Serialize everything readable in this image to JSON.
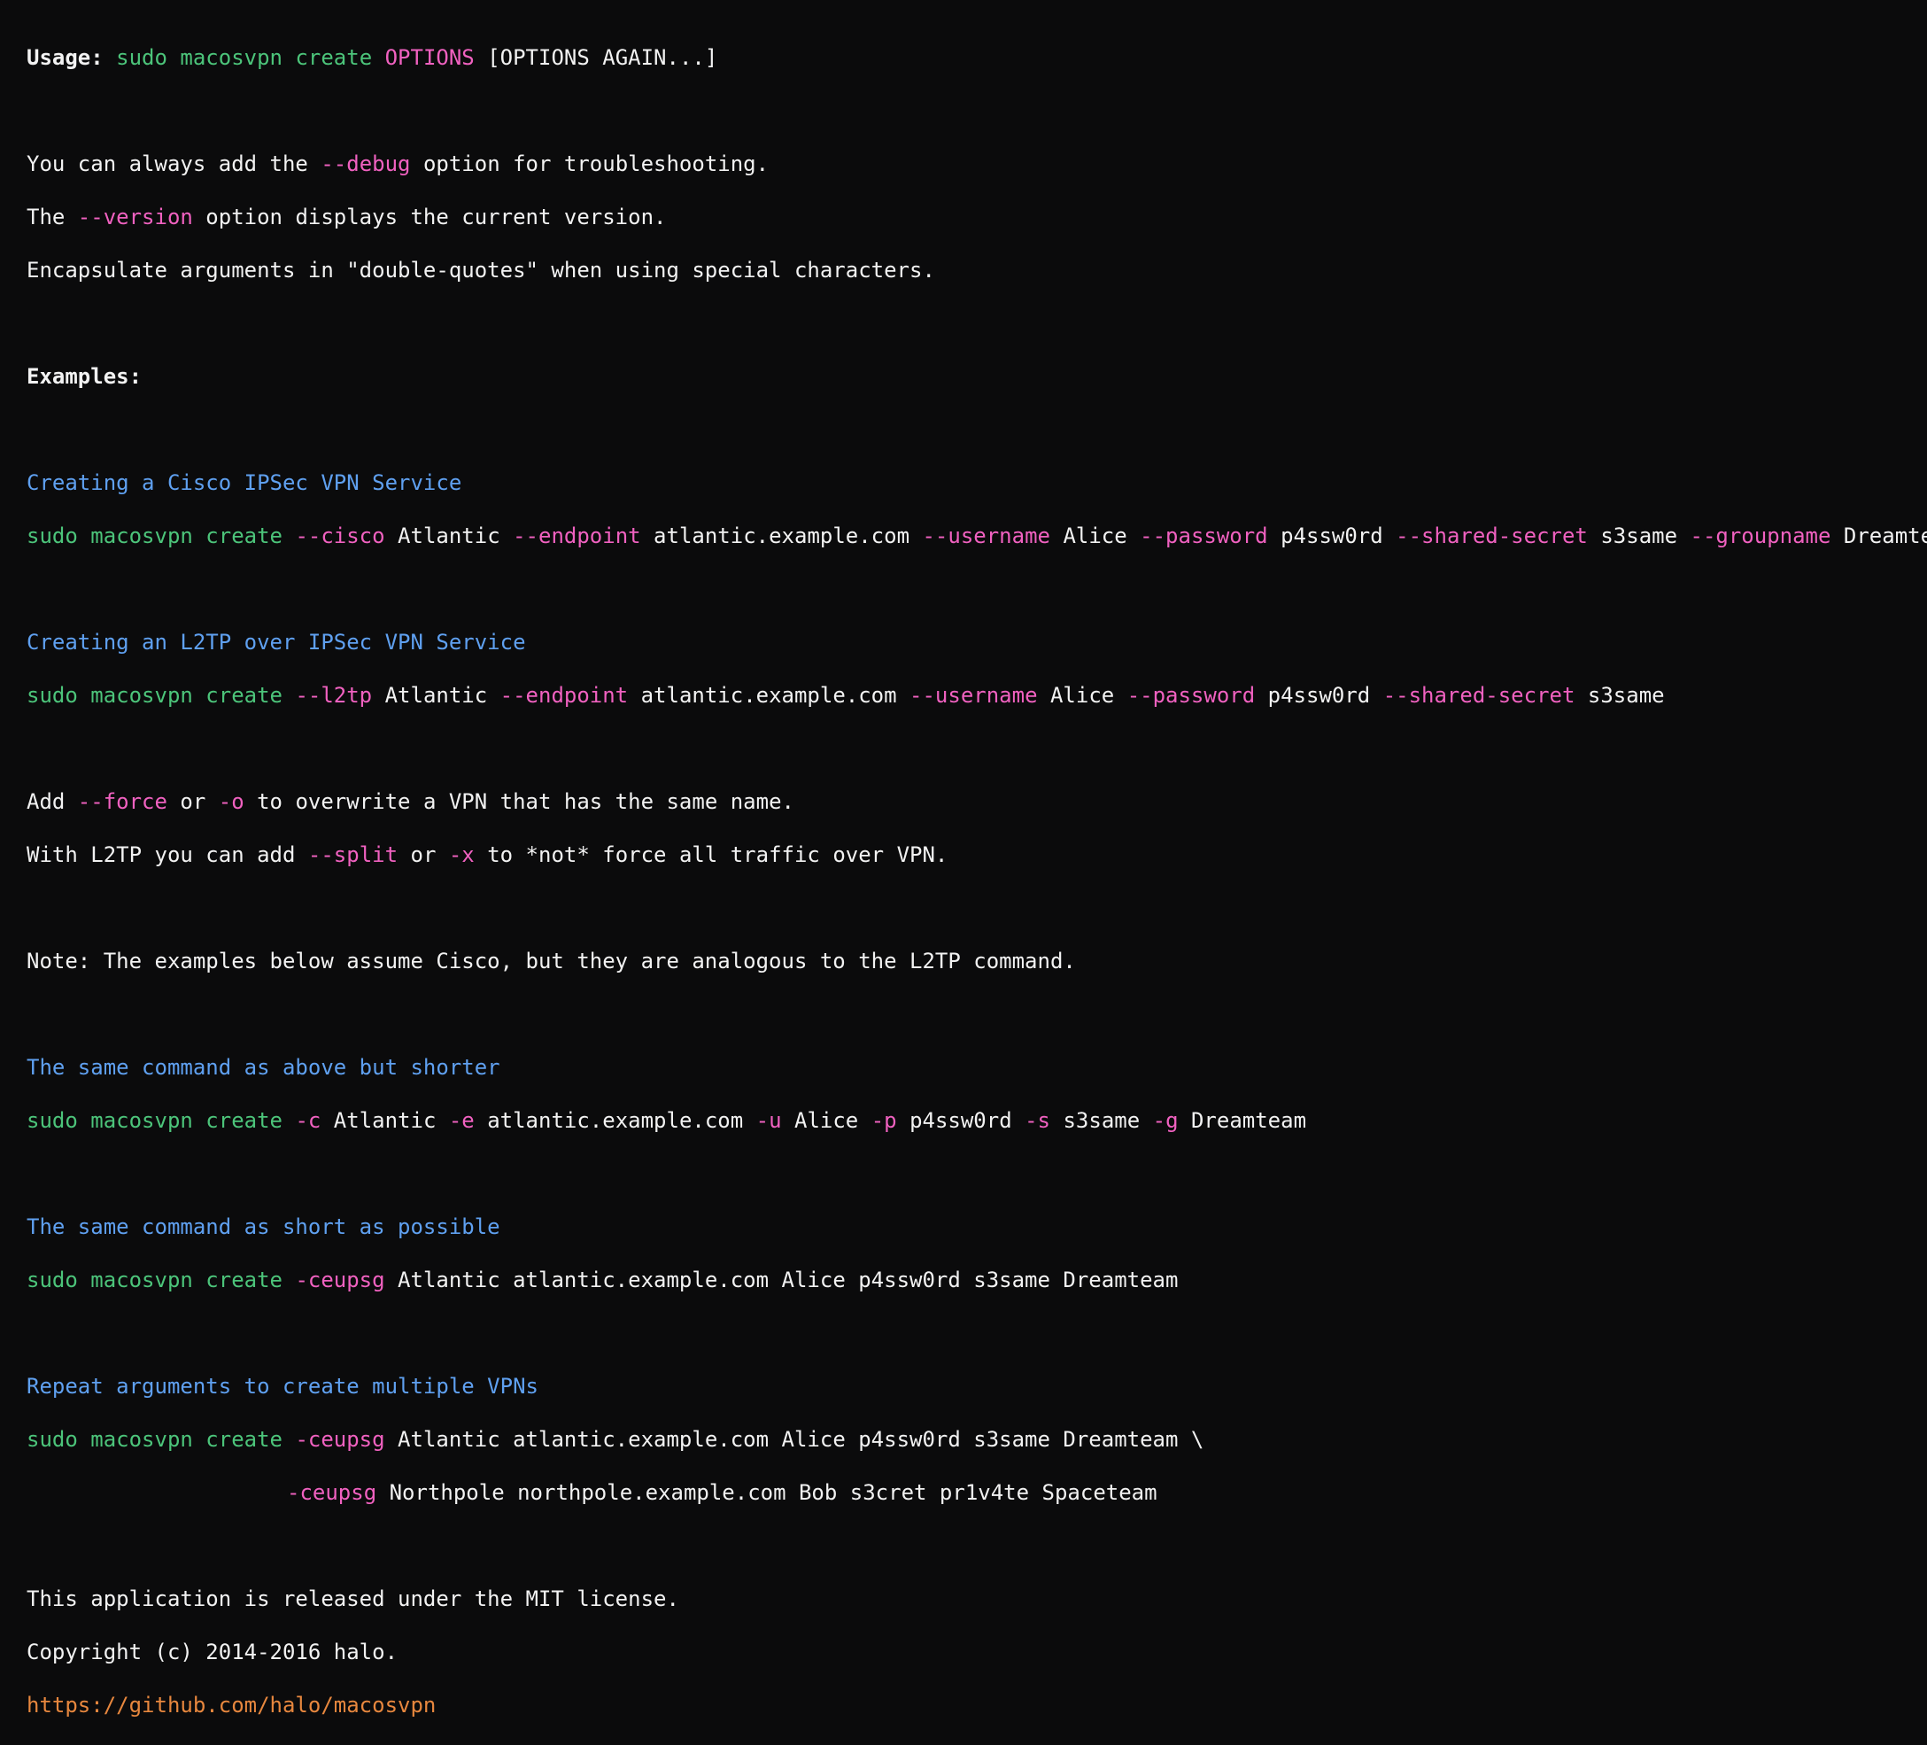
{
  "usage": {
    "label": "Usage:",
    "command": "sudo macosvpn create",
    "options": "OPTIONS",
    "rest": "[OPTIONS AGAIN...]"
  },
  "intro": {
    "debug_pre": "You can always add the ",
    "debug_flag": "--debug",
    "debug_post": " option for troubleshooting.",
    "version_pre": "The ",
    "version_flag": "--version",
    "version_post": " option displays the current version.",
    "encapsulate": "Encapsulate arguments in \"double-quotes\" when using special characters."
  },
  "examples_heading": "Examples:",
  "cisco": {
    "heading": "Creating a Cisco IPSec VPN Service",
    "cmd": "sudo macosvpn create",
    "f1": "--cisco",
    "v1": "Atlantic",
    "f2": "--endpoint",
    "v2": "atlantic.example.com",
    "f3": "--username",
    "v3": "Alice",
    "f4": "--password",
    "v4": "p4ssw0rd",
    "f5": "--shared-secret",
    "v5": "s3same",
    "f6": "--groupname",
    "v6": "Dreamteam"
  },
  "l2tp": {
    "heading": "Creating an L2TP over IPSec VPN Service",
    "cmd": "sudo macosvpn create",
    "f1": "--l2tp",
    "v1": "Atlantic",
    "f2": "--endpoint",
    "v2": "atlantic.example.com",
    "f3": "--username",
    "v3": "Alice",
    "f4": "--password",
    "v4": "p4ssw0rd",
    "f5": "--shared-secret",
    "v5": "s3same"
  },
  "force": {
    "pre": "Add ",
    "flag1": "--force",
    "mid": " or ",
    "flag2": "-o",
    "post": " to overwrite a VPN that has the same name."
  },
  "split": {
    "pre": "With L2TP you can add ",
    "flag1": "--split",
    "mid": " or ",
    "flag2": "-x",
    "post": " to *not* force all traffic over VPN."
  },
  "note": "Note: The examples below assume Cisco, but they are analogous to the L2TP command.",
  "shorter": {
    "heading": "The same command as above but shorter",
    "cmd": "sudo macosvpn create",
    "f1": "-c",
    "v1": "Atlantic",
    "f2": "-e",
    "v2": "atlantic.example.com",
    "f3": "-u",
    "v3": "Alice",
    "f4": "-p",
    "v4": "p4ssw0rd",
    "f5": "-s",
    "v5": "s3same",
    "f6": "-g",
    "v6": "Dreamteam"
  },
  "shortest": {
    "heading": "The same command as short as possible",
    "cmd": "sudo macosvpn create",
    "flag": "-ceupsg",
    "args": "Atlantic atlantic.example.com Alice p4ssw0rd s3same Dreamteam"
  },
  "multiple": {
    "heading": "Repeat arguments to create multiple VPNs",
    "cmd": "sudo macosvpn create",
    "flag1": "-ceupsg",
    "args1": "Atlantic atlantic.example.com Alice p4ssw0rd s3same Dreamteam \\",
    "flag2": "-ceupsg",
    "args2": "Northpole northpole.example.com Bob s3cret pr1v4te Spaceteam"
  },
  "footer": {
    "license": "This application is released under the MIT license.",
    "copyright": "Copyright (c) 2014-2016 halo.",
    "url": "https://github.com/halo/macosvpn"
  },
  "colors": {
    "background": "#0b0b0c",
    "text": "#f2f2f2",
    "command": "#4cc47a",
    "flag": "#f061c0",
    "heading": "#5fa0f0",
    "link": "#e7873e"
  }
}
